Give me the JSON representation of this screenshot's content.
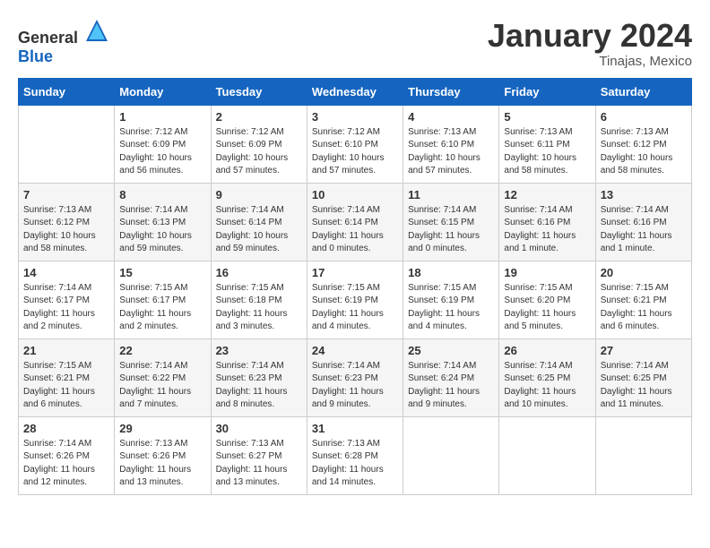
{
  "header": {
    "logo_general": "General",
    "logo_blue": "Blue",
    "month_year": "January 2024",
    "location": "Tinajas, Mexico"
  },
  "days_of_week": [
    "Sunday",
    "Monday",
    "Tuesday",
    "Wednesday",
    "Thursday",
    "Friday",
    "Saturday"
  ],
  "weeks": [
    [
      {
        "day": "",
        "info": ""
      },
      {
        "day": "1",
        "info": "Sunrise: 7:12 AM\nSunset: 6:09 PM\nDaylight: 10 hours\nand 56 minutes."
      },
      {
        "day": "2",
        "info": "Sunrise: 7:12 AM\nSunset: 6:09 PM\nDaylight: 10 hours\nand 57 minutes."
      },
      {
        "day": "3",
        "info": "Sunrise: 7:12 AM\nSunset: 6:10 PM\nDaylight: 10 hours\nand 57 minutes."
      },
      {
        "day": "4",
        "info": "Sunrise: 7:13 AM\nSunset: 6:10 PM\nDaylight: 10 hours\nand 57 minutes."
      },
      {
        "day": "5",
        "info": "Sunrise: 7:13 AM\nSunset: 6:11 PM\nDaylight: 10 hours\nand 58 minutes."
      },
      {
        "day": "6",
        "info": "Sunrise: 7:13 AM\nSunset: 6:12 PM\nDaylight: 10 hours\nand 58 minutes."
      }
    ],
    [
      {
        "day": "7",
        "info": "Sunrise: 7:13 AM\nSunset: 6:12 PM\nDaylight: 10 hours\nand 58 minutes."
      },
      {
        "day": "8",
        "info": "Sunrise: 7:14 AM\nSunset: 6:13 PM\nDaylight: 10 hours\nand 59 minutes."
      },
      {
        "day": "9",
        "info": "Sunrise: 7:14 AM\nSunset: 6:14 PM\nDaylight: 10 hours\nand 59 minutes."
      },
      {
        "day": "10",
        "info": "Sunrise: 7:14 AM\nSunset: 6:14 PM\nDaylight: 11 hours\nand 0 minutes."
      },
      {
        "day": "11",
        "info": "Sunrise: 7:14 AM\nSunset: 6:15 PM\nDaylight: 11 hours\nand 0 minutes."
      },
      {
        "day": "12",
        "info": "Sunrise: 7:14 AM\nSunset: 6:16 PM\nDaylight: 11 hours\nand 1 minute."
      },
      {
        "day": "13",
        "info": "Sunrise: 7:14 AM\nSunset: 6:16 PM\nDaylight: 11 hours\nand 1 minute."
      }
    ],
    [
      {
        "day": "14",
        "info": "Sunrise: 7:14 AM\nSunset: 6:17 PM\nDaylight: 11 hours\nand 2 minutes."
      },
      {
        "day": "15",
        "info": "Sunrise: 7:15 AM\nSunset: 6:17 PM\nDaylight: 11 hours\nand 2 minutes."
      },
      {
        "day": "16",
        "info": "Sunrise: 7:15 AM\nSunset: 6:18 PM\nDaylight: 11 hours\nand 3 minutes."
      },
      {
        "day": "17",
        "info": "Sunrise: 7:15 AM\nSunset: 6:19 PM\nDaylight: 11 hours\nand 4 minutes."
      },
      {
        "day": "18",
        "info": "Sunrise: 7:15 AM\nSunset: 6:19 PM\nDaylight: 11 hours\nand 4 minutes."
      },
      {
        "day": "19",
        "info": "Sunrise: 7:15 AM\nSunset: 6:20 PM\nDaylight: 11 hours\nand 5 minutes."
      },
      {
        "day": "20",
        "info": "Sunrise: 7:15 AM\nSunset: 6:21 PM\nDaylight: 11 hours\nand 6 minutes."
      }
    ],
    [
      {
        "day": "21",
        "info": "Sunrise: 7:15 AM\nSunset: 6:21 PM\nDaylight: 11 hours\nand 6 minutes."
      },
      {
        "day": "22",
        "info": "Sunrise: 7:14 AM\nSunset: 6:22 PM\nDaylight: 11 hours\nand 7 minutes."
      },
      {
        "day": "23",
        "info": "Sunrise: 7:14 AM\nSunset: 6:23 PM\nDaylight: 11 hours\nand 8 minutes."
      },
      {
        "day": "24",
        "info": "Sunrise: 7:14 AM\nSunset: 6:23 PM\nDaylight: 11 hours\nand 9 minutes."
      },
      {
        "day": "25",
        "info": "Sunrise: 7:14 AM\nSunset: 6:24 PM\nDaylight: 11 hours\nand 9 minutes."
      },
      {
        "day": "26",
        "info": "Sunrise: 7:14 AM\nSunset: 6:25 PM\nDaylight: 11 hours\nand 10 minutes."
      },
      {
        "day": "27",
        "info": "Sunrise: 7:14 AM\nSunset: 6:25 PM\nDaylight: 11 hours\nand 11 minutes."
      }
    ],
    [
      {
        "day": "28",
        "info": "Sunrise: 7:14 AM\nSunset: 6:26 PM\nDaylight: 11 hours\nand 12 minutes."
      },
      {
        "day": "29",
        "info": "Sunrise: 7:13 AM\nSunset: 6:26 PM\nDaylight: 11 hours\nand 13 minutes."
      },
      {
        "day": "30",
        "info": "Sunrise: 7:13 AM\nSunset: 6:27 PM\nDaylight: 11 hours\nand 13 minutes."
      },
      {
        "day": "31",
        "info": "Sunrise: 7:13 AM\nSunset: 6:28 PM\nDaylight: 11 hours\nand 14 minutes."
      },
      {
        "day": "",
        "info": ""
      },
      {
        "day": "",
        "info": ""
      },
      {
        "day": "",
        "info": ""
      }
    ]
  ]
}
